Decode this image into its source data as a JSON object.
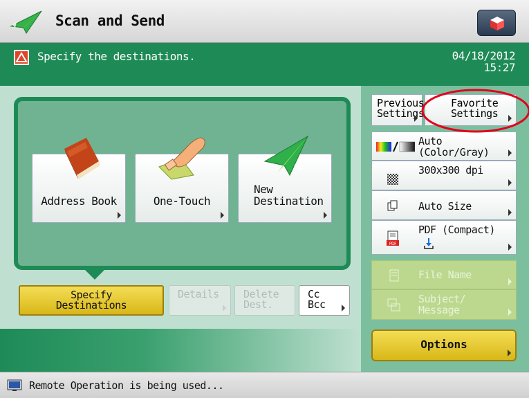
{
  "header": {
    "title": "Scan and Send",
    "title_icon": "paper-plane-icon",
    "home_icon": "home-cube-icon"
  },
  "message": {
    "text": "Specify the destinations.",
    "icon": "warning-icon",
    "date": "04/18/2012",
    "time": "15:27"
  },
  "destinations": [
    {
      "label_line1": "Address Book",
      "label_line2": "",
      "icon": "address-book-icon"
    },
    {
      "label_line1": "One-Touch",
      "label_line2": "",
      "icon": "one-touch-hand-icon"
    },
    {
      "label_line1": "New",
      "label_line2": "Destination",
      "icon": "new-destination-plane-icon"
    }
  ],
  "actions": {
    "specify_line1": "Specify",
    "specify_line2": "Destinations",
    "details": "Details",
    "delete_line1": "Delete",
    "delete_line2": "Dest.",
    "cc_line1": "Cc",
    "cc_line2": "Bcc"
  },
  "settings": {
    "previous_line1": "Previous",
    "previous_line2": "Settings",
    "favorite_line1": "Favorite",
    "favorite_line2": "Settings",
    "color_line1": "Auto",
    "color_line2": "(Color/Gray)",
    "resolution": "300x300 dpi",
    "size": "Auto Size",
    "format_line1": "PDF (Compact)",
    "file_name": "File Name",
    "subject_line1": "Subject/",
    "subject_line2": "Message",
    "options": "Options"
  },
  "status": {
    "text": "Remote Operation is being used...",
    "icon": "remote-monitor-icon"
  },
  "colors": {
    "brand_green": "#1e8b57",
    "panel_green": "#6fb392",
    "light_green": "#bfe0d0",
    "yellow": "#e8c932",
    "highlight_red": "#e3001b"
  }
}
